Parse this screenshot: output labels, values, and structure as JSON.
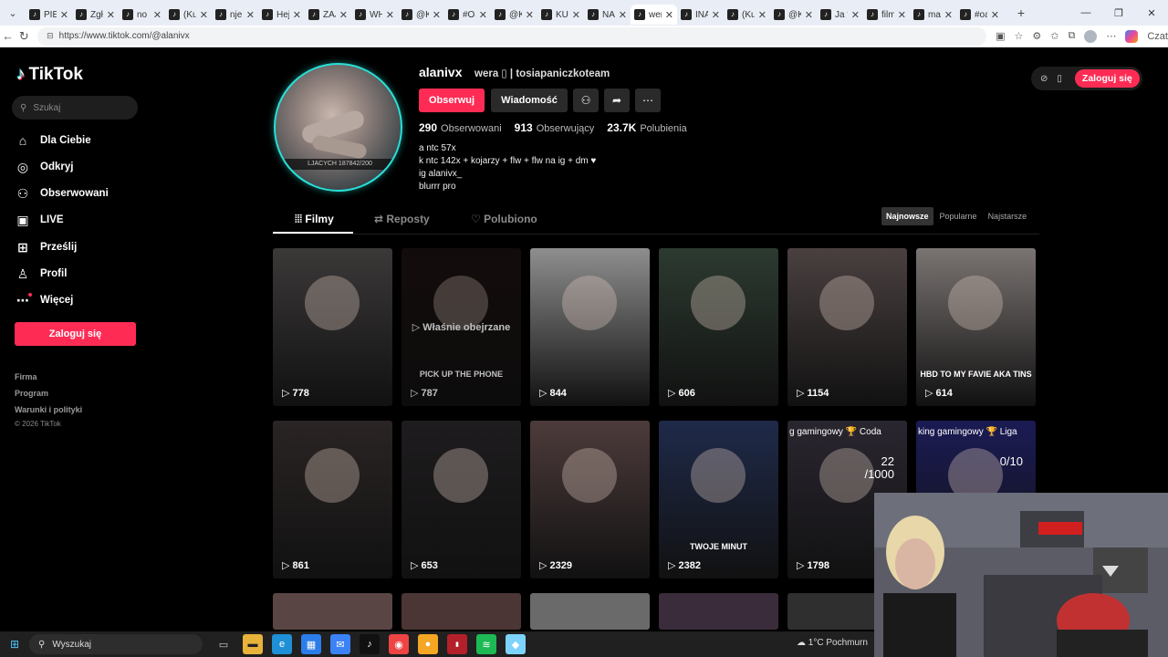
{
  "browser": {
    "tabs": [
      {
        "label": "PIER",
        "active": false
      },
      {
        "label": "Zgło",
        "active": false
      },
      {
        "label": "no t",
        "active": false
      },
      {
        "label": "(Kul",
        "active": false
      },
      {
        "label": "nje",
        "active": false
      },
      {
        "label": "Hej",
        "active": false
      },
      {
        "label": "ZAJI",
        "active": false
      },
      {
        "label": "WH",
        "active": false
      },
      {
        "label": "@Ki",
        "active": false
      },
      {
        "label": "#OJ",
        "active": false
      },
      {
        "label": "@Ki",
        "active": false
      },
      {
        "label": "KUE",
        "active": false
      },
      {
        "label": "NA",
        "active": false
      },
      {
        "label": "wera",
        "active": true
      },
      {
        "label": "INA",
        "active": false
      },
      {
        "label": "(Kul",
        "active": false
      },
      {
        "label": "@Ki",
        "active": false
      },
      {
        "label": "Ja tu",
        "active": false
      },
      {
        "label": "film",
        "active": false
      },
      {
        "label": "may",
        "active": false
      },
      {
        "label": "#oa",
        "active": false
      }
    ],
    "url": "https://www.tiktok.com/@alanivx",
    "copilot_label": "Czat"
  },
  "sidebar": {
    "brand": "TikTok",
    "search_placeholder": "Szukaj",
    "nav": [
      {
        "label": "Dla Ciebie",
        "icon": "home-icon"
      },
      {
        "label": "Odkryj",
        "icon": "compass-icon"
      },
      {
        "label": "Obserwowani",
        "icon": "following-icon"
      },
      {
        "label": "LIVE",
        "icon": "live-icon"
      },
      {
        "label": "Prześlij",
        "icon": "upload-icon"
      },
      {
        "label": "Profil",
        "icon": "profile-icon"
      },
      {
        "label": "Więcej",
        "icon": "more-icon"
      }
    ],
    "login_label": "Zaloguj się",
    "footer": [
      "Firma",
      "Program",
      "Warunki i polityki"
    ],
    "copyright": "© 2026 TikTok"
  },
  "profile": {
    "username": "alanivx",
    "nickname": "wera ▯ | tosiapaniczkoteam",
    "avatar_banner": "LJACYCH 187842/200",
    "follow_label": "Obserwuj",
    "message_label": "Wiadomość",
    "stats": [
      {
        "value": "290",
        "label": "Obserwowani"
      },
      {
        "value": "913",
        "label": "Obserwujący"
      },
      {
        "value": "23.7K",
        "label": "Polubienia"
      }
    ],
    "bio": [
      "a ntc 57x",
      "k ntc 142x + kojarzy + flw + flw na ig + dm ♥",
      "ig alanivx_",
      "blurrr pro"
    ]
  },
  "topbar": {
    "login_label": "Zaloguj się"
  },
  "content_tabs": [
    {
      "label": "Filmy",
      "active": true
    },
    {
      "label": "Reposty",
      "active": false
    },
    {
      "label": "Polubiono",
      "active": false
    }
  ],
  "sort": [
    {
      "label": "Najnowsze",
      "selected": true
    },
    {
      "label": "Popularne",
      "selected": false
    },
    {
      "label": "Najstarsze",
      "selected": false
    }
  ],
  "videos": [
    {
      "views": "778",
      "bg": "#3b3838",
      "overlay": "",
      "caption": "",
      "topcap": "",
      "score": ""
    },
    {
      "views": "787",
      "bg": "#1a1010",
      "overlay": "▷ Właśnie obejrzane",
      "caption": "PICK UP THE PHONE",
      "topcap": "",
      "score": ""
    },
    {
      "views": "844",
      "bg": "#8e8e8e",
      "overlay": "",
      "caption": "",
      "topcap": "",
      "score": ""
    },
    {
      "views": "606",
      "bg": "#2c3a30",
      "overlay": "",
      "caption": "",
      "topcap": "",
      "score": ""
    },
    {
      "views": "1154",
      "bg": "#4a4040",
      "overlay": "",
      "caption": "",
      "topcap": "",
      "score": ""
    },
    {
      "views": "614",
      "bg": "#7a7472",
      "overlay": "",
      "caption": "HBD TO MY FAVIE AKA TINS",
      "topcap": "",
      "score": ""
    },
    {
      "views": "861",
      "bg": "#2a2424",
      "overlay": "",
      "caption": "",
      "topcap": "",
      "score": ""
    },
    {
      "views": "653",
      "bg": "#1e1c1e",
      "overlay": "",
      "caption": "",
      "topcap": "",
      "score": ""
    },
    {
      "views": "2329",
      "bg": "#4d3b3b",
      "overlay": "",
      "caption": "",
      "topcap": "",
      "score": ""
    },
    {
      "views": "2382",
      "bg": "#1f2a4a",
      "overlay": "",
      "caption": "TWOJE MINUT",
      "topcap": "",
      "score": ""
    },
    {
      "views": "1798",
      "bg": "#2a2630",
      "overlay": "",
      "caption": "",
      "topcap": "g gamingowy  🏆 Coda",
      "score": "22\n/1000"
    },
    {
      "views": "",
      "bg": "#1b1b55",
      "overlay": "",
      "caption": "",
      "topcap": "king gamingowy  🏆 Liga",
      "score": "0/10"
    }
  ],
  "taskbar": {
    "search_placeholder": "Wyszukaj",
    "weather": "1°C  Pochmurn"
  },
  "colors": {
    "accent": "#fe2c55",
    "teal": "#25f4ee"
  }
}
